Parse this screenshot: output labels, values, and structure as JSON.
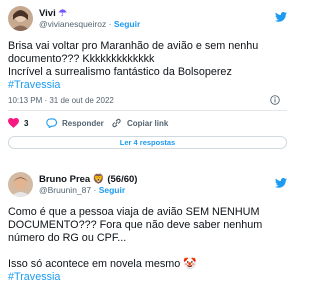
{
  "tweet1": {
    "display_name": "Vivi",
    "name_emoji": "☂",
    "handle": "@vivianesqueiroz",
    "separator": "·",
    "follow_label": "Seguir",
    "lines": [
      "Brisa vai voltar pro Maranhão de avião e sem nenhu",
      "documento??? Kkkkkkkkkkkkk",
      "Incrível a surrealismo fantástico da Bolsoperez"
    ],
    "hashtag": "#Travessia",
    "timestamp": "10:13 PM · 31 de out de 2022",
    "like_count": "3",
    "reply_label": "Responder",
    "copy_label": "Copiar link",
    "read_replies_label": "Ler 4 respostas"
  },
  "tweet2": {
    "display_name": "Bruno Prea",
    "name_emoji": "🦁",
    "name_suffix": "(56/60)",
    "handle": "@Bruunin_87",
    "separator": "·",
    "follow_label": "Seguir",
    "lines": [
      "Como é que a pessoa viaja de avião SEM NENHUM",
      "DOCUMENTO??? Fora que não deve saber nenhum",
      "número do RG ou CPF..."
    ],
    "line_extra": "Isso só acontece em novela mesmo",
    "line_extra_emoji": "🤡",
    "hashtag": "#Travessia"
  },
  "colors": {
    "accent": "#1d9bf0",
    "like": "#f91880",
    "muted": "#536471"
  },
  "icons": [
    "heart-icon",
    "reply-icon",
    "link-icon",
    "info-icon",
    "twitter-logo-icon"
  ]
}
